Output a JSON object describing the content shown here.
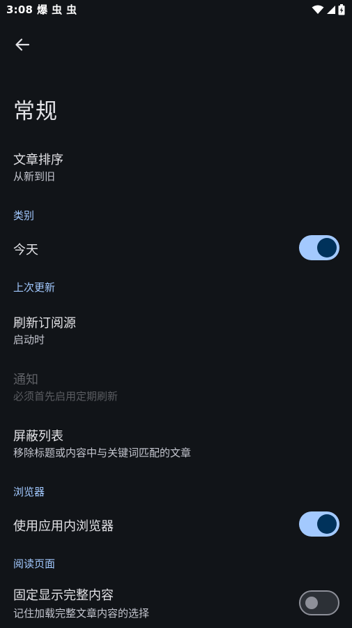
{
  "status_bar": {
    "time": "3:08",
    "notification_icons": [
      "爆",
      "虫",
      "虫"
    ],
    "icons": [
      "wifi-icon",
      "signal-icon",
      "battery-charging-icon"
    ]
  },
  "page": {
    "title": "常规"
  },
  "prefs": {
    "article_sort": {
      "title": "文章排序",
      "summary": "从新到旧"
    },
    "cat_category": "类别",
    "today": {
      "title": "今天",
      "switch_on": true
    },
    "cat_last_update": "上次更新",
    "refresh_sources": {
      "title": "刷新订阅源",
      "summary": "启动时"
    },
    "notifications": {
      "title": "通知",
      "summary": "必须首先启用定期刷新",
      "enabled": false
    },
    "block_list": {
      "title": "屏蔽列表",
      "summary": "移除标题或内容中与关键词匹配的文章"
    },
    "cat_browser": "浏览器",
    "in_app_browser": {
      "title": "使用应用内浏览器",
      "switch_on": true
    },
    "cat_reading": "阅读页面",
    "full_content": {
      "title": "固定显示完整内容",
      "summary": "记住加载完整文章内容的选择",
      "switch_on": false
    }
  },
  "colors": {
    "background": "#111418",
    "accent": "#a2c9ff",
    "switch_track_on": "#a3c9fe",
    "switch_thumb_on": "#00325b"
  }
}
